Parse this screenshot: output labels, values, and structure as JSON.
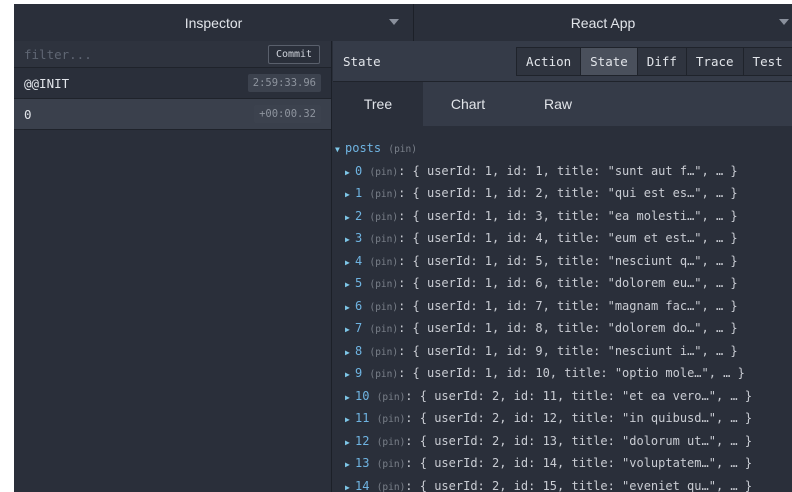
{
  "header": {
    "left_select": "Inspector",
    "right_select": "React App"
  },
  "left_pane": {
    "filter_placeholder": "filter...",
    "commit_label": "Commit",
    "actions": [
      {
        "name": "@@INIT",
        "time": "2:59:33.96"
      },
      {
        "name": "0",
        "time": "+00:00.32"
      }
    ]
  },
  "right_pane": {
    "title": "State",
    "tabs": [
      "Action",
      "State",
      "Diff",
      "Trace",
      "Test"
    ],
    "active_tab": "State",
    "subtabs": [
      "Tree",
      "Chart",
      "Raw"
    ],
    "active_subtab": "Tree",
    "tree": {
      "root_key": "posts",
      "root_pin": "(pin)",
      "items": [
        {
          "key": "0",
          "pin": "(pin)",
          "summary": ": { userId: 1, id: 1, title: \"sunt aut f…\", … }"
        },
        {
          "key": "1",
          "pin": "(pin)",
          "summary": ": { userId: 1, id: 2, title: \"qui est es…\", … }"
        },
        {
          "key": "2",
          "pin": "(pin)",
          "summary": ": { userId: 1, id: 3, title: \"ea molesti…\", … }"
        },
        {
          "key": "3",
          "pin": "(pin)",
          "summary": ": { userId: 1, id: 4, title: \"eum et est…\", … }"
        },
        {
          "key": "4",
          "pin": "(pin)",
          "summary": ": { userId: 1, id: 5, title: \"nesciunt q…\", … }"
        },
        {
          "key": "5",
          "pin": "(pin)",
          "summary": ": { userId: 1, id: 6, title: \"dolorem eu…\", … }"
        },
        {
          "key": "6",
          "pin": "(pin)",
          "summary": ": { userId: 1, id: 7, title: \"magnam fac…\", … }"
        },
        {
          "key": "7",
          "pin": "(pin)",
          "summary": ": { userId: 1, id: 8, title: \"dolorem do…\", … }"
        },
        {
          "key": "8",
          "pin": "(pin)",
          "summary": ": { userId: 1, id: 9, title: \"nesciunt i…\", … }"
        },
        {
          "key": "9",
          "pin": "(pin)",
          "summary": ": { userId: 1, id: 10, title: \"optio mole…\", … }"
        },
        {
          "key": "10",
          "pin": "(pin)",
          "summary": ": { userId: 2, id: 11, title: \"et ea vero…\", … }"
        },
        {
          "key": "11",
          "pin": "(pin)",
          "summary": ": { userId: 2, id: 12, title: \"in quibusd…\", … }"
        },
        {
          "key": "12",
          "pin": "(pin)",
          "summary": ": { userId: 2, id: 13, title: \"dolorum ut…\", … }"
        },
        {
          "key": "13",
          "pin": "(pin)",
          "summary": ": { userId: 2, id: 14, title: \"voluptatem…\", … }"
        },
        {
          "key": "14",
          "pin": "(pin)",
          "summary": ": { userId: 2, id: 15, title: \"eveniet qu…\", … }"
        }
      ]
    }
  },
  "icons": {
    "expanded": "triangle-down-icon",
    "collapsed": "triangle-right-icon",
    "dropdown": "chevron-down-icon"
  }
}
